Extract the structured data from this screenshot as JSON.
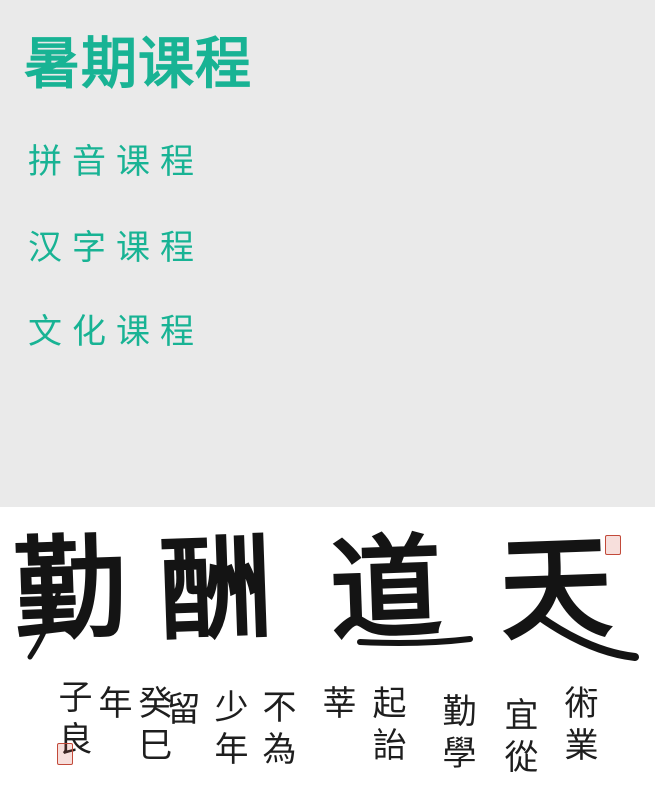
{
  "menu": {
    "title": "暑期课程",
    "items": [
      {
        "label": "拼音课程"
      },
      {
        "label": "汉字课程"
      },
      {
        "label": "文化课程"
      }
    ]
  },
  "calligraphy": {
    "main_chars": [
      "勤",
      "酬",
      "道",
      "天"
    ],
    "inscription_columns": [
      "術業",
      "宜從",
      "勤學",
      "起詒",
      "莘",
      "不為",
      "少年",
      "留",
      "癸巳年",
      "子良"
    ]
  },
  "colors": {
    "accent": "#18b394",
    "panel_background": "#eaeaea",
    "ink": "#141414",
    "seal_red": "#c24a3a"
  }
}
